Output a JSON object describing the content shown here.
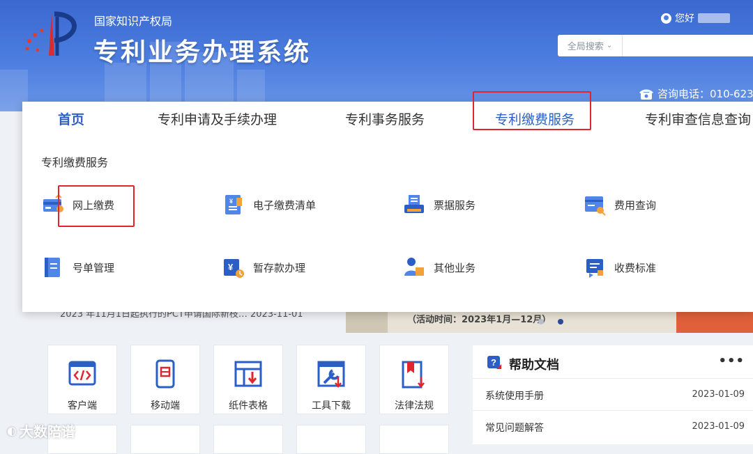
{
  "header": {
    "org": "国家知识产权局",
    "system_title": "专利业务办理系统",
    "greeting": "您好",
    "search_scope": "全局搜索",
    "hotline": "咨询电话：010-623"
  },
  "nav": {
    "items": [
      {
        "label": "首页"
      },
      {
        "label": "专利申请及手续办理"
      },
      {
        "label": "专利事务服务"
      },
      {
        "label": "专利缴费服务"
      },
      {
        "label": "专利审查信息查询"
      }
    ]
  },
  "panel": {
    "section_title": "专利缴费服务",
    "services": [
      {
        "label": "网上缴费",
        "icon": "card-icon"
      },
      {
        "label": "电子缴费清单",
        "icon": "receipt-list-icon"
      },
      {
        "label": "票据服务",
        "icon": "printer-icon"
      },
      {
        "label": "费用查询",
        "icon": "fee-search-icon"
      },
      {
        "label": "号单管理",
        "icon": "ledger-icon"
      },
      {
        "label": "暂存款办理",
        "icon": "deposit-icon"
      },
      {
        "label": "其他业务",
        "icon": "person-icon"
      },
      {
        "label": "收费标准",
        "icon": "standard-icon"
      }
    ]
  },
  "background": {
    "news_fragment": "2023 年11月1日起执行的PCT申请国际新枝…   2023-11-01",
    "banner_text": "（活动时间：2023年1月—12月）"
  },
  "tools": [
    {
      "label": "客户端",
      "icon": "code-icon"
    },
    {
      "label": "移动端",
      "icon": "mobile-icon"
    },
    {
      "label": "纸件表格",
      "icon": "form-download-icon"
    },
    {
      "label": "工具下载",
      "icon": "tool-icon"
    },
    {
      "label": "法律法规",
      "icon": "law-icon"
    }
  ],
  "help": {
    "title": "帮助文档",
    "more": "•••",
    "docs": [
      {
        "title": "系统使用手册",
        "date": "2023-01-09"
      },
      {
        "title": "常见问题解答",
        "date": "2023-01-09"
      }
    ]
  },
  "watermark": "大数陪谱",
  "colors": {
    "brand_blue": "#2c5fc6",
    "header_blue": "#4c7ee0",
    "highlight_red": "#e0262c"
  }
}
